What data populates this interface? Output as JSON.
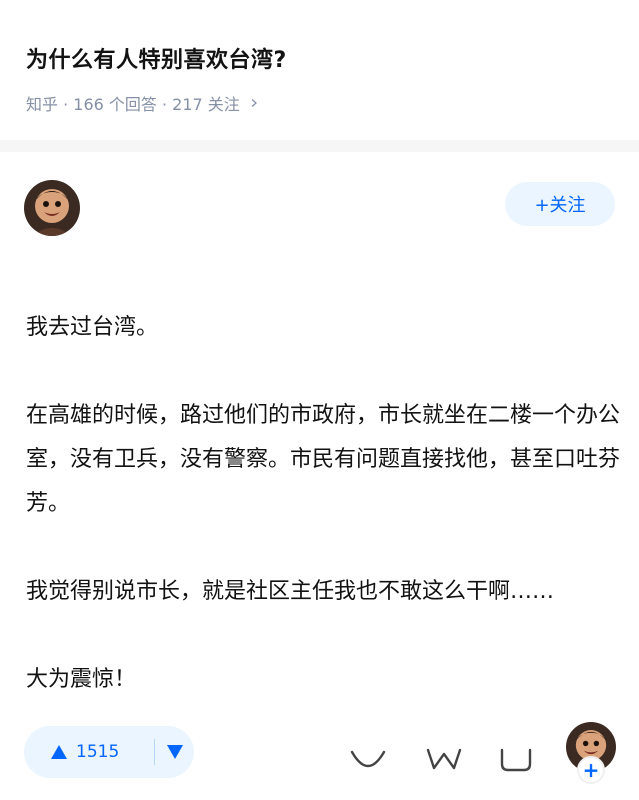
{
  "question": {
    "title": "为什么有人特别喜欢台湾?",
    "meta": "知乎 · 166 个回答 · 217 关注"
  },
  "author": {
    "follow_label": "+关注",
    "avatar_icon": "cartoon-avatar"
  },
  "answer": {
    "paragraphs": [
      "我去过台湾。",
      "在高雄的时候，路过他们的市政府，市长就坐在二楼一个办公室，没有卫兵，没有警察。市民有问题直接找他，甚至口吐芬芳。",
      "我觉得别说市长，就是社区主任我也不敢这么干啊……",
      "大为震惊！"
    ]
  },
  "actions": {
    "upvote_count": "1515",
    "icons": [
      "upvote-icon",
      "downvote-icon",
      "collect-icon",
      "like-icon",
      "comment-icon"
    ],
    "follow_badge": "+"
  },
  "colors": {
    "accent": "#0066ff",
    "accent_bg": "#ebf5ff",
    "meta_gray": "#8590a6"
  }
}
